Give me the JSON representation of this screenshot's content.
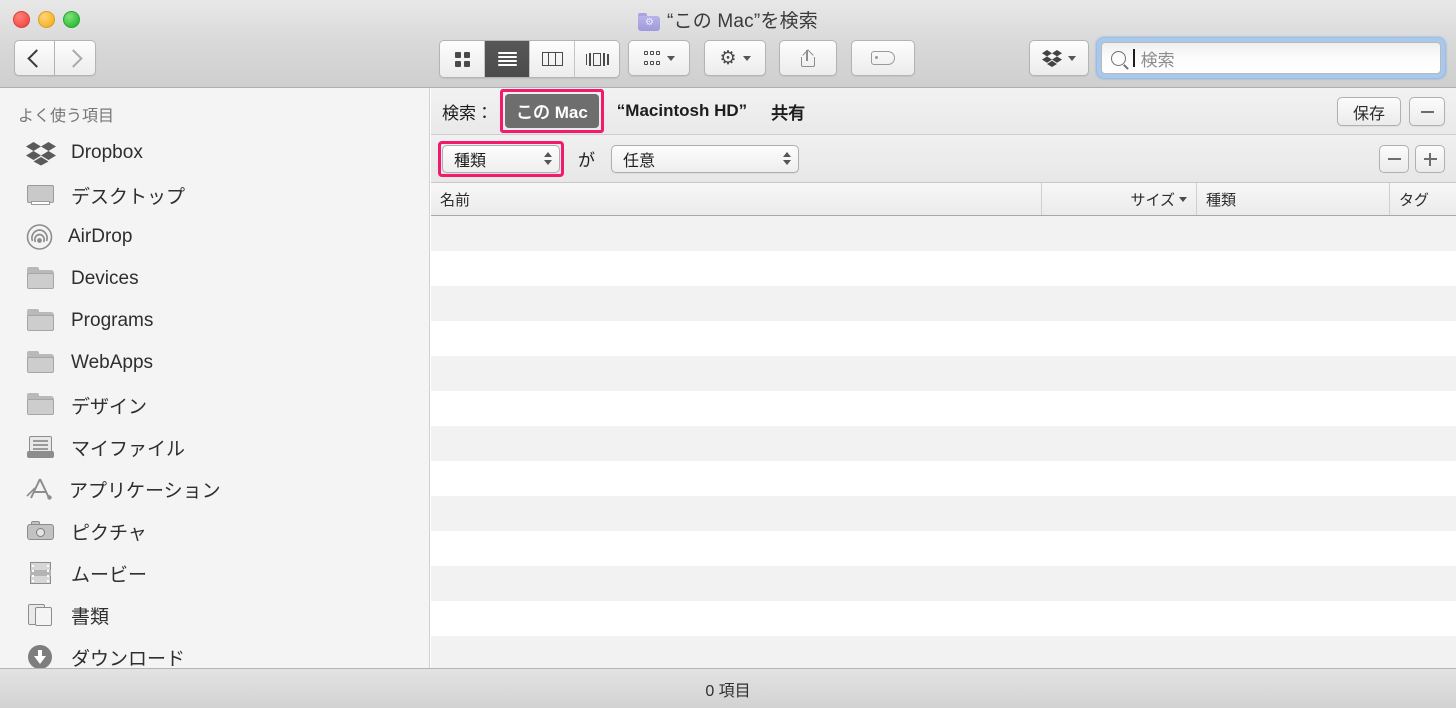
{
  "window": {
    "title": "“この Mac”を検索",
    "title_icon": "smart-folder-icon",
    "traffic_lights": [
      "close-button",
      "minimize-button",
      "zoom-button"
    ]
  },
  "toolbar": {
    "back_label": "",
    "forward_label": "",
    "view_modes": [
      {
        "name": "icon-view",
        "selected": false
      },
      {
        "name": "list-view",
        "selected": true
      },
      {
        "name": "column-view",
        "selected": false
      },
      {
        "name": "coverflow-view",
        "selected": false
      }
    ],
    "arrange_icon": "arrange-icon",
    "action_icon": "gear-icon",
    "share_icon": "share-icon",
    "tag_icon": "tag-icon",
    "dropbox_icon": "dropbox-icon"
  },
  "search": {
    "placeholder": "検索",
    "value": "",
    "focused": true,
    "icon": "search-icon"
  },
  "sidebar": {
    "header": "よく使う項目",
    "items": [
      {
        "label": "Dropbox",
        "icon": "dropbox-icon"
      },
      {
        "label": "デスクトップ",
        "icon": "desktop-icon"
      },
      {
        "label": "AirDrop",
        "icon": "airdrop-icon"
      },
      {
        "label": "Devices",
        "icon": "folder-icon"
      },
      {
        "label": "Programs",
        "icon": "folder-icon"
      },
      {
        "label": "WebApps",
        "icon": "folder-icon"
      },
      {
        "label": "デザイン",
        "icon": "folder-icon"
      },
      {
        "label": "マイファイル",
        "icon": "all-my-files-icon"
      },
      {
        "label": "アプリケーション",
        "icon": "applications-icon"
      },
      {
        "label": "ピクチャ",
        "icon": "pictures-icon"
      },
      {
        "label": "ムービー",
        "icon": "movies-icon"
      },
      {
        "label": "書類",
        "icon": "documents-icon"
      },
      {
        "label": "ダウンロード",
        "icon": "downloads-icon"
      }
    ]
  },
  "scope_bar": {
    "label": "検索：",
    "options": [
      {
        "label": "この Mac",
        "selected": true,
        "highlighted": true
      },
      {
        "label": "“Macintosh HD”",
        "selected": false,
        "highlighted": false
      },
      {
        "label": "共有",
        "selected": false,
        "highlighted": false
      }
    ],
    "save_label": "保存",
    "remove_label": "−"
  },
  "criteria": {
    "attribute": {
      "value": "種類",
      "highlighted": true
    },
    "conjunction": "が",
    "operand": {
      "value": "任意",
      "highlighted": false
    },
    "remove_label": "−",
    "add_label": "+"
  },
  "list": {
    "columns": [
      {
        "label": "名前",
        "sorted": false
      },
      {
        "label": "サイズ",
        "sorted": true
      },
      {
        "label": "種類",
        "sorted": false
      },
      {
        "label": "タグ",
        "sorted": false
      }
    ],
    "rows": []
  },
  "statusbar": {
    "item_count_label": "0 項目"
  },
  "colors": {
    "highlight": "#f5196e",
    "selected_scope_bg": "#6e6e6e",
    "focus_ring": "#a8c8ee",
    "row_stripe": "#f2f2f2"
  }
}
